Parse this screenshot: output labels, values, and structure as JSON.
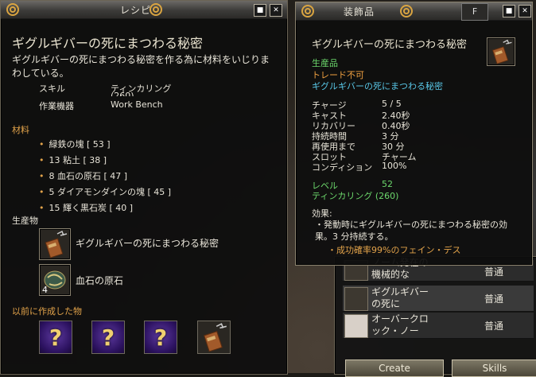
{
  "recipe_window": {
    "title": "レシピ",
    "item_name": "ギグルギバーの死にまつわる秘密",
    "description": "ギグルギバーの死にまつわる秘密を作る為に材料をいじりまわしている。",
    "skill_label": "スキル",
    "skill_value": "ティンカリング",
    "skill_level": "(260)",
    "station_label": "作業機器",
    "station_value": "Work Bench",
    "materials_header": "材料",
    "materials": [
      "緑鉄の塊 [ 53 ]",
      "13 粘土 [ 38 ]",
      "8 血石の原石 [ 47 ]",
      "5 ダイアモンダインの塊 [ 45 ]",
      "15 輝く黒石炭 [ 40 ]"
    ],
    "products_header": "生産物",
    "products": [
      {
        "name": "ギグルギバーの死にまつわる秘密",
        "count": ""
      },
      {
        "name": "血石の原石",
        "count": "4"
      }
    ],
    "previous_header": "以前に作成した物",
    "previous_slots": [
      "?",
      "?",
      "?"
    ]
  },
  "tooltip_window": {
    "title": "装飾品",
    "item_name": "ギグルギバーの死にまつわる秘密",
    "type": "生産品",
    "flag": "トレード不可",
    "set_name": "ギグルギバーの死にまつわる秘密",
    "stats": [
      {
        "label": "チャージ",
        "value": "5 / 5"
      },
      {
        "label": "キャスト",
        "value": "2.40秒"
      },
      {
        "label": "リカバリー",
        "value": "0.40秒"
      },
      {
        "label": "持続時間",
        "value": "3 分"
      },
      {
        "label": "再使用まで",
        "value": "30 分"
      },
      {
        "label": "スロット",
        "value": "チャーム"
      },
      {
        "label": "コンディション",
        "value": "100%"
      }
    ],
    "level_label": "レベル",
    "level_value": "52",
    "req_skill": "ティンカリング (260)",
    "effect_header": "効果:",
    "effect_text": "・発動時にギグルギバーの死にまつわる秘密の効果。3 分持続する。",
    "effect_sub": "・成功確率99%のフェイン・デス"
  },
  "craft_list": {
    "tab_label": "F",
    "rows": [
      {
        "name": "ノーム発在の機械的な",
        "quality": "普通"
      },
      {
        "name": "ギグルギバーの死に",
        "quality": "普通"
      },
      {
        "name": "オーバークロック・ノー",
        "quality": "普通"
      }
    ],
    "create_button": "Create",
    "skills_button": "Skills"
  },
  "colors": {
    "accent_gold": "#e2a34a",
    "green": "#6cd86c",
    "cyan": "#58c6e6",
    "orange": "#f0a040"
  }
}
